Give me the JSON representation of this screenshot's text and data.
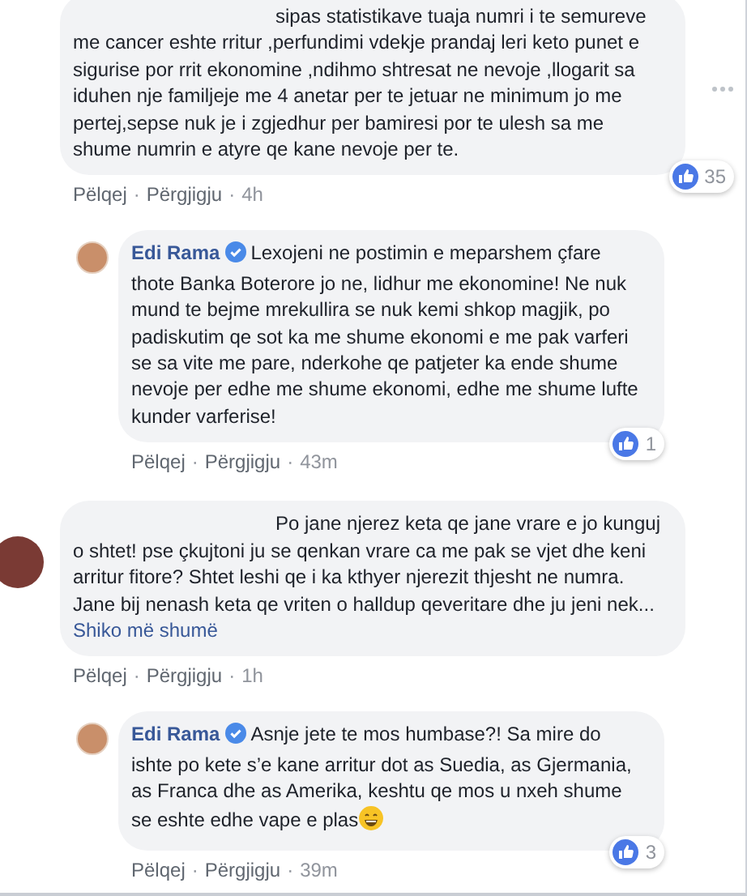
{
  "comments": [
    {
      "text": "sipas statistikave tuaja numri i te semureve me cancer eshte rritur ,perfundimi vdekje prandaj leri keto punet e sigurise por rrit ekonomine ,ndihmo shtresat ne nevoje ,llogarit sa iduhen nje familjeje me 4 anetar per te jetuar ne minimum jo me pertej,sepse nuk je i zgjedhur per bamiresi por te ulesh sa me shume numrin e atyre qe kane nevoje per te.",
      "has_menu": true,
      "likes": "35",
      "actions": [
        "Pëlqej",
        "Përgjigju"
      ],
      "separator": "·",
      "time": "4h",
      "children": [
        {
          "author": "Edi Rama",
          "verified": true,
          "text": "Lexojeni ne postimin e meparshem çfare thote Banka Boterore jo ne, lidhur me ekonomine! Ne nuk mund te bejme mrekullira se nuk kemi shkop magjik, po padiskutim qe sot ka me shume ekonomi e me pak varferi se sa vite me pare, nderkohe qe patjeter ka ende shume nevoje per edhe me shume ekonomi, edhe me shume lufte kunder varferise!",
          "likes": "1",
          "actions": [
            "Pëlqej",
            "Përgjigju"
          ],
          "separator": "·",
          "time": "43m"
        }
      ]
    },
    {
      "text": "Po jane njerez keta qe jane vrare e jo kunguj o shtet! pse çkujtoni ju se qenkan vrare ca me pak se vjet dhe keni arritur fitore? Shtet leshi qe i ka kthyer njerezit thjesht ne numra. Jane bij nenash keta qe vriten o halldup qeveritare dhe ju jeni nek...",
      "see_more": "Shiko më shumë",
      "has_menu": false,
      "actions": [
        "Pëlqej",
        "Përgjigju"
      ],
      "separator": "·",
      "time": "1h",
      "children": [
        {
          "author": "Edi Rama",
          "verified": true,
          "text": "Asnje jete te mos humbase?! Sa mire do ishte po kete s’e kane arritur dot as Suedia, as Gjermania, as Franca dhe as Amerika, keshtu qe mos u nxeh shume se eshte edhe vape e plas",
          "ends_with_emoji": true,
          "likes": "3",
          "actions": [
            "Pëlqej",
            "Përgjigju"
          ],
          "separator": "·",
          "time": "39m"
        }
      ]
    }
  ]
}
